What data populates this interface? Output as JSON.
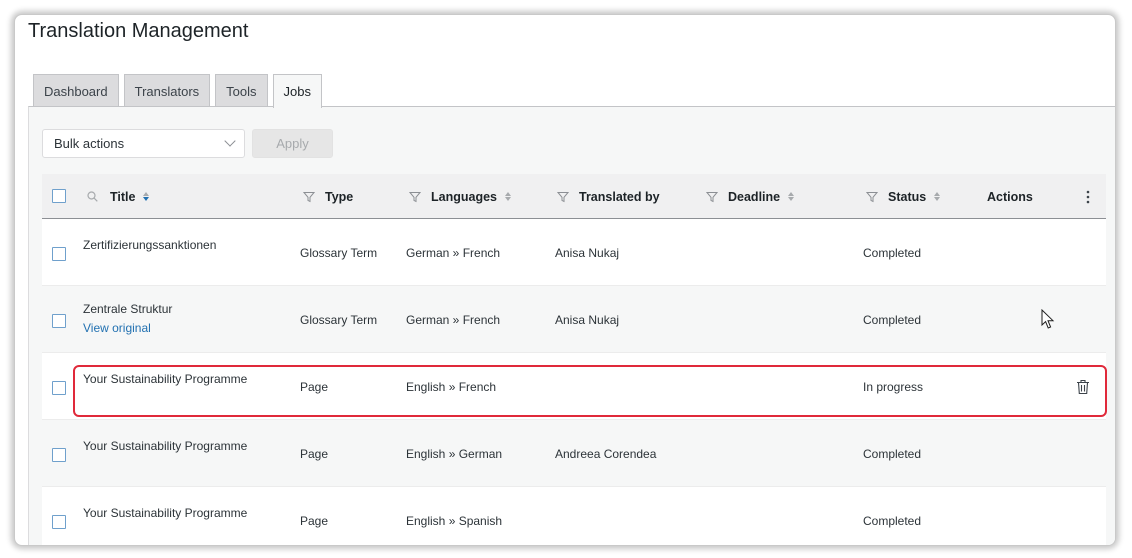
{
  "page": {
    "title": "Translation Management"
  },
  "tabs": [
    {
      "label": "Dashboard",
      "active": false
    },
    {
      "label": "Translators",
      "active": false
    },
    {
      "label": "Tools",
      "active": false
    },
    {
      "label": "Jobs",
      "active": true
    }
  ],
  "toolbar": {
    "bulk_actions": "Bulk actions",
    "apply_label": "Apply"
  },
  "table": {
    "columns": {
      "title": "Title",
      "type": "Type",
      "languages": "Languages",
      "translated_by": "Translated by",
      "deadline": "Deadline",
      "status": "Status",
      "actions": "Actions"
    },
    "rows": [
      {
        "title": "Zertifizierungssanktionen",
        "link": "",
        "type": "Glossary Term",
        "languages": "German » French",
        "translated_by": "Anisa Nukaj",
        "deadline": "",
        "status": "Completed"
      },
      {
        "title": "Zentrale Struktur",
        "link": "View original",
        "type": "Glossary Term",
        "languages": "German » French",
        "translated_by": "Anisa Nukaj",
        "deadline": "",
        "status": "Completed"
      },
      {
        "title": "Your Sustainability Programme",
        "link": "",
        "type": "Page",
        "languages": "English » French",
        "translated_by": "",
        "deadline": "",
        "status": "In progress"
      },
      {
        "title": "Your Sustainability Programme",
        "link": "",
        "type": "Page",
        "languages": "English » German",
        "translated_by": "Andreea Corendea",
        "deadline": "",
        "status": "Completed"
      },
      {
        "title": "Your Sustainability Programme",
        "link": "",
        "type": "Page",
        "languages": "English » Spanish",
        "translated_by": "",
        "deadline": "",
        "status": "Completed"
      }
    ]
  },
  "colors": {
    "accent": "#2271b1",
    "highlight": "#e0293a"
  },
  "icons": [
    "search-icon",
    "filter-icon",
    "sort-icon",
    "kebab-menu-icon",
    "trash-icon",
    "mouse-cursor-icon"
  ]
}
